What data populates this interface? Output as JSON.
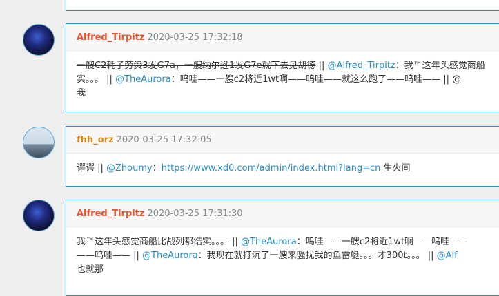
{
  "comments": [
    {
      "user": "Alfred_Tirpitz",
      "user_color": "#e0552f",
      "date": "2020-03-25 17:32:18",
      "body": [
        [
          {
            "t": "一艘C2耗子劳资3发G7a，一艘纳尔逊1发G7e就下去见胡德",
            "c": "del"
          },
          {
            "t": " || ",
            "c": "plain"
          },
          {
            "t": "@Alfred_Tirpitz",
            "c": "mention"
          },
          {
            "t": "：我™这年头感觉商船",
            "c": "plain"
          }
        ],
        [
          {
            "t": "实。。。 || ",
            "c": "plain"
          },
          {
            "t": "@TheAurora",
            "c": "mention"
          },
          {
            "t": "：呜哇——一艘c2将近1wt啊——呜哇——就这么跑了——呜哇—— || @",
            "c": "plain"
          }
        ],
        [
          {
            "t": "我",
            "c": "plain"
          }
        ]
      ]
    },
    {
      "user": "fhh_orz",
      "user_color": "#d98a1e",
      "date": "2020-03-25 17:32:05",
      "body": [
        [
          {
            "t": "谔谔 || ",
            "c": "plain"
          },
          {
            "t": "@Zhoumy",
            "c": "mention"
          },
          {
            "t": "：",
            "c": "plain"
          },
          {
            "t": "https://www.xd0.com/admin/index.html?lang=cn",
            "c": "mention"
          },
          {
            "t": " 生火间",
            "c": "plain"
          }
        ]
      ]
    },
    {
      "user": "Alfred_Tirpitz",
      "user_color": "#e0552f",
      "date": "2020-03-25 17:31:30",
      "body": [
        [
          {
            "t": "我™这年头感觉商船比战列都结实。。。",
            "c": "del"
          },
          {
            "t": " || ",
            "c": "plain"
          },
          {
            "t": "@TheAurora",
            "c": "mention"
          },
          {
            "t": "：呜哇——一艘c2将近1wt啊——呜哇——",
            "c": "plain"
          }
        ],
        [
          {
            "t": "——呜哇—— || ",
            "c": "plain"
          },
          {
            "t": "@TheAurora",
            "c": "mention"
          },
          {
            "t": "：我现在就打沉了一艘来骚扰我的鱼雷艇。。。才300t。。。 || ",
            "c": "plain"
          },
          {
            "t": "@Alf",
            "c": "mention"
          }
        ],
        [
          {
            "t": "也就那",
            "c": "plain"
          }
        ]
      ]
    }
  ]
}
